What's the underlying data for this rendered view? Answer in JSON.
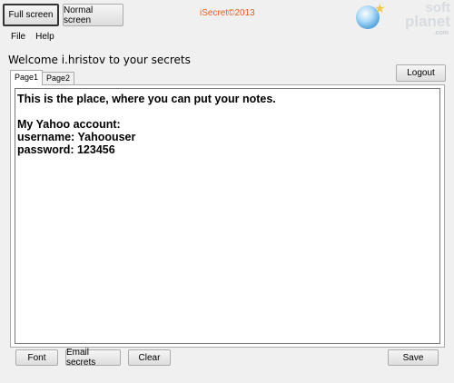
{
  "toolbar": {
    "full_screen_label": "Full screen",
    "normal_screen_label": "Normal screen",
    "app_title": "iSecret©2013"
  },
  "watermark": {
    "line1": "soft",
    "line2": "planet",
    "line3": ".com",
    "logo": "globe-star-icon"
  },
  "menu": {
    "items": [
      {
        "label": "File"
      },
      {
        "label": "Help"
      }
    ]
  },
  "welcome_text": "Welcome i.hristov to your secrets",
  "logout_label": "Logout",
  "tabs": [
    {
      "label": "Page1",
      "active": true
    },
    {
      "label": "Page2",
      "active": false
    }
  ],
  "notes": {
    "content": "This is the place, where you can put your notes.\n\nMy Yahoo account:\nusername: Yahoouser\npassword: 123456"
  },
  "actions": {
    "font_label": "Font",
    "email_label": "Email secrets",
    "clear_label": "Clear",
    "save_label": "Save"
  },
  "colors": {
    "title_orange": "#e8601c",
    "window_bg": "#f0f0f0"
  }
}
